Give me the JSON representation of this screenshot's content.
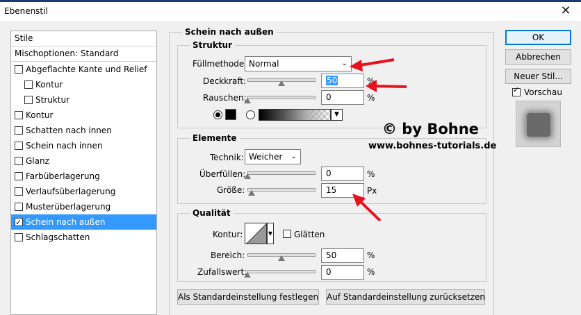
{
  "window": {
    "title": "Ebenenstil",
    "close_glyph": "✕"
  },
  "styles_list": {
    "header": "Stile",
    "blend_options": "Mischoptionen: Standard",
    "items": [
      {
        "label": "Abgeflachte Kante und Relief",
        "checked": false,
        "indent": false
      },
      {
        "label": "Kontur",
        "checked": false,
        "indent": true
      },
      {
        "label": "Struktur",
        "checked": false,
        "indent": true
      },
      {
        "label": "Kontur",
        "checked": false,
        "indent": false
      },
      {
        "label": "Schatten nach innen",
        "checked": false,
        "indent": false
      },
      {
        "label": "Schein nach innen",
        "checked": false,
        "indent": false
      },
      {
        "label": "Glanz",
        "checked": false,
        "indent": false
      },
      {
        "label": "Farbüberlagerung",
        "checked": false,
        "indent": false
      },
      {
        "label": "Verlaufsüberlagerung",
        "checked": false,
        "indent": false
      },
      {
        "label": "Musterüberlagerung",
        "checked": false,
        "indent": false
      },
      {
        "label": "Schein nach außen",
        "checked": true,
        "indent": false,
        "selected": true
      },
      {
        "label": "Schlagschatten",
        "checked": false,
        "indent": false
      }
    ]
  },
  "outer_glow": {
    "title": "Schein nach außen",
    "structure": {
      "title": "Struktur",
      "blend_mode_label": "Füllmethode:",
      "blend_mode_value": "Normal",
      "opacity_label": "Deckkraft:",
      "opacity_value": "50",
      "opacity_level": 0.5,
      "noise_label": "Rauschen:",
      "noise_value": "0",
      "noise_level": 0.0,
      "unit_percent": "%"
    },
    "elements": {
      "title": "Elemente",
      "technique_label": "Technik:",
      "technique_value": "Weicher",
      "spread_label": "Überfüllen:",
      "spread_value": "0",
      "spread_level": 0.0,
      "size_label": "Größe:",
      "size_value": "15",
      "size_level": 0.06,
      "unit_percent": "%",
      "unit_px": "Px"
    },
    "quality": {
      "title": "Qualität",
      "contour_label": "Kontur:",
      "antialias_label": "Glätten",
      "range_label": "Bereich:",
      "range_value": "50",
      "range_level": 0.5,
      "jitter_label": "Zufallswert:",
      "jitter_value": "0",
      "jitter_level": 0.0,
      "unit_percent": "%"
    },
    "make_default": "Als Standardeinstellung festlegen",
    "reset_default": "Auf Standardeinstellung zurücksetzen"
  },
  "buttons": {
    "ok": "OK",
    "cancel": "Abbrechen",
    "new_style": "Neuer Stil...",
    "preview_label": "Vorschau"
  },
  "watermark": {
    "line1": "© by Bohne",
    "line2": "www.bohnes-tutorials.de"
  },
  "colors": {
    "selection": "#3399ff",
    "annotation_arrow": "#e8121e",
    "glow_color": "#000000"
  }
}
